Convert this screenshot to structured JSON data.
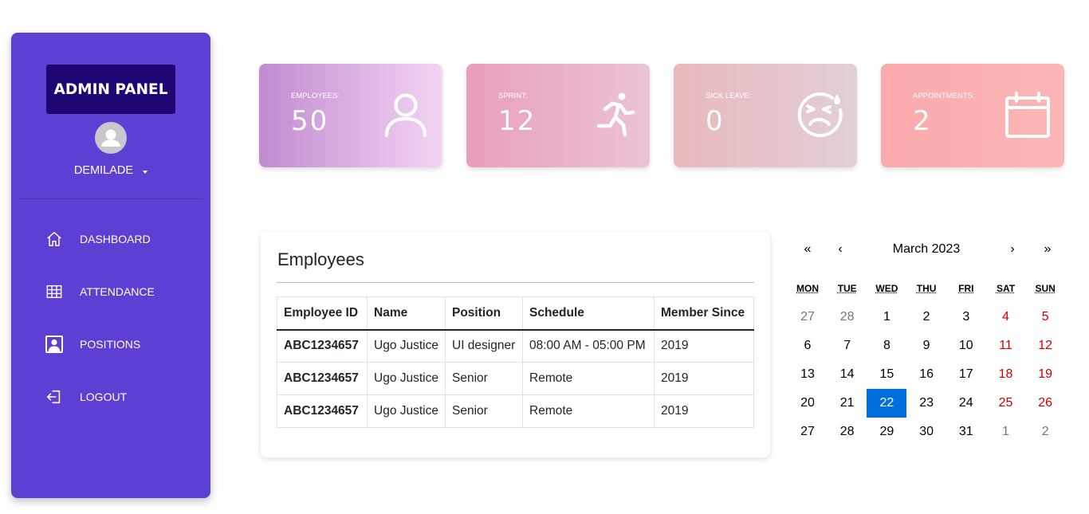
{
  "sidebar": {
    "brand": "ADMIN PANEL",
    "user": {
      "name": "DEMILADE"
    },
    "nav": [
      {
        "label": "DASHBOARD",
        "icon": "home-icon"
      },
      {
        "label": "ATTENDANCE",
        "icon": "table-grid-icon"
      },
      {
        "label": "POSITIONS",
        "icon": "person-badge-icon"
      },
      {
        "label": "LOGOUT",
        "icon": "logout-icon"
      }
    ],
    "color": "#5e3fd3",
    "brand_color": "#1f0474"
  },
  "cards": [
    {
      "label": "EMPLOYEES:",
      "value": "50",
      "icon": "person-icon",
      "gradient": [
        "#c28bd0",
        "#f3d4f3"
      ]
    },
    {
      "label": "SPRINT:",
      "value": "12",
      "icon": "running-icon",
      "gradient": [
        "#e89ebd",
        "#ecc3d6"
      ]
    },
    {
      "label": "SICK LEAVE:",
      "value": "0",
      "icon": "sick-face-icon",
      "gradient": [
        "#e8b9bd",
        "#e2cfd6"
      ]
    },
    {
      "label": "APPOINTMENTS:",
      "value": "2",
      "icon": "calendar-icon",
      "gradient": [
        "#fbaaad",
        "#fcb6b6"
      ]
    }
  ],
  "employees": {
    "title": "Employees",
    "columns": [
      "Employee ID",
      "Name",
      "Position",
      "Schedule",
      "Member Since"
    ],
    "rows": [
      [
        "ABC1234657",
        "Ugo Justice",
        "UI designer",
        "08:00 AM - 05:00 PM",
        "2019"
      ],
      [
        "ABC1234657",
        "Ugo Justice",
        "Senior",
        "Remote",
        "2019"
      ],
      [
        "ABC1234657",
        "Ugo Justice",
        "Senior",
        "Remote",
        "2019"
      ]
    ]
  },
  "calendar": {
    "nav": {
      "prev_year": "«",
      "prev_month": "‹",
      "next_month": "›",
      "next_year": "»"
    },
    "title": "March 2023",
    "weekdays": [
      "MON",
      "TUE",
      "WED",
      "THU",
      "FRI",
      "SAT",
      "SUN"
    ],
    "weeks": [
      [
        "27",
        "28",
        "1",
        "2",
        "3",
        "4",
        "5"
      ],
      [
        "6",
        "7",
        "8",
        "9",
        "10",
        "11",
        "12"
      ],
      [
        "13",
        "14",
        "15",
        "16",
        "17",
        "18",
        "19"
      ],
      [
        "20",
        "21",
        "22",
        "23",
        "24",
        "25",
        "26"
      ],
      [
        "27",
        "28",
        "29",
        "30",
        "31",
        "1",
        "2"
      ]
    ],
    "selected": "22",
    "colors": {
      "selected": "#006edc",
      "weekend": "#d10000",
      "neighbor": "#757575"
    }
  }
}
